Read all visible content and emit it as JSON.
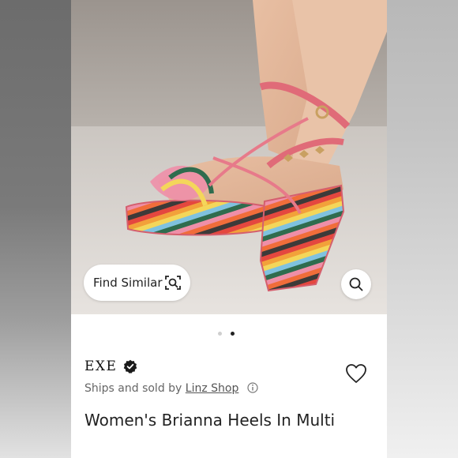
{
  "listing": {
    "find_similar_label": "Find Similar",
    "brand": "EXE",
    "ships_prefix": "Ships and sold by",
    "shop_name": "Linz Shop",
    "title": "Women's Brianna Heels In Multi",
    "image_count": 2,
    "active_image": 2
  },
  "icons": {
    "find_similar": "image-search-icon",
    "search": "search-icon",
    "verified": "verified-badge-icon",
    "info": "info-icon",
    "favorite": "heart-outline-icon"
  },
  "colors": {
    "verified_badge": "#1a1a1a",
    "active_dot": "#222222",
    "inactive_dot": "#cfcfcf",
    "shoe_straps": "#e77a8a"
  }
}
